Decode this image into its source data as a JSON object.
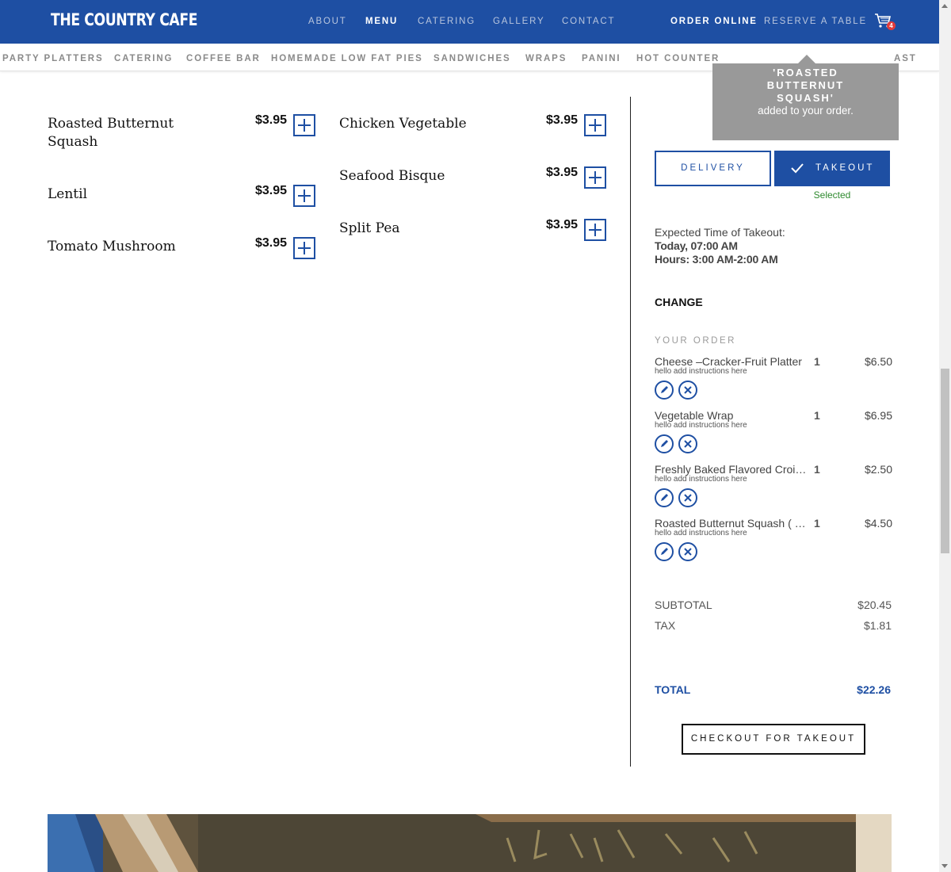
{
  "brand": {
    "logo_text": "THE COUNTRY CAFE",
    "primary_color": "#1e4fa3",
    "badge_color": "#e23b3b",
    "success_color": "#2e8a2e"
  },
  "nav": {
    "about": "ABOUT",
    "menu": "MENU",
    "catering": "CATERING",
    "gallery": "GALLERY",
    "contact": "CONTACT",
    "order_online": "ORDER ONLINE",
    "reserve": "RESERVE A TABLE",
    "cart_count": "4"
  },
  "subnav": {
    "items": [
      "PARTY PLATTERS",
      "CATERING",
      "COFFEE BAR",
      "HOMEMADE LOW FAT PIES",
      "SANDWICHES",
      "WRAPS",
      "PANINI",
      "HOT COUNTER",
      "AST"
    ]
  },
  "tooltip": {
    "item_name": "'ROASTED BUTTERNUT SQUASH'",
    "message": "added to your order."
  },
  "menu": {
    "left": [
      {
        "name": "Roasted Butternut Squash",
        "price": "$3.95"
      },
      {
        "name": "Lentil",
        "price": "$3.95"
      },
      {
        "name": "Tomato Mushroom",
        "price": "$3.95"
      }
    ],
    "right": [
      {
        "name": "Chicken Vegetable",
        "price": "$3.95"
      },
      {
        "name": "Seafood Bisque",
        "price": "$3.95"
      },
      {
        "name": "Split Pea",
        "price": "$3.95"
      }
    ]
  },
  "order_panel": {
    "delivery_label": "DELIVERY",
    "takeout_label": "TAKEOUT",
    "selected_text": "Selected",
    "expected_label": "Expected Time of Takeout:",
    "expected_time": "Today, 07:00 AM",
    "hours": "Hours: 3:00 AM-2:00 AM",
    "change_label": "CHANGE",
    "your_order_label": "YOUR ORDER",
    "items": [
      {
        "name": "Cheese –Cracker-Fruit Platter",
        "qty": "1",
        "price": "$6.50",
        "note": "hello add instructions here"
      },
      {
        "name": "Vegetable Wrap",
        "qty": "1",
        "price": "$6.95",
        "note": "hello add instructions here"
      },
      {
        "name": "Freshly Baked Flavored Croissant",
        "qty": "1",
        "price": "$2.50",
        "note": "hello add instructions here"
      },
      {
        "name": "Roasted Butternut Squash ( Cup )",
        "qty": "1",
        "price": "$4.50",
        "note": "hello add instructions here"
      }
    ],
    "subtotal_label": "SUBTOTAL",
    "subtotal_value": "$20.45",
    "tax_label": "TAX",
    "tax_value": "$1.81",
    "total_label": "TOTAL",
    "total_value": "$22.26",
    "checkout_label": "CHECKOUT FOR TAKEOUT"
  }
}
